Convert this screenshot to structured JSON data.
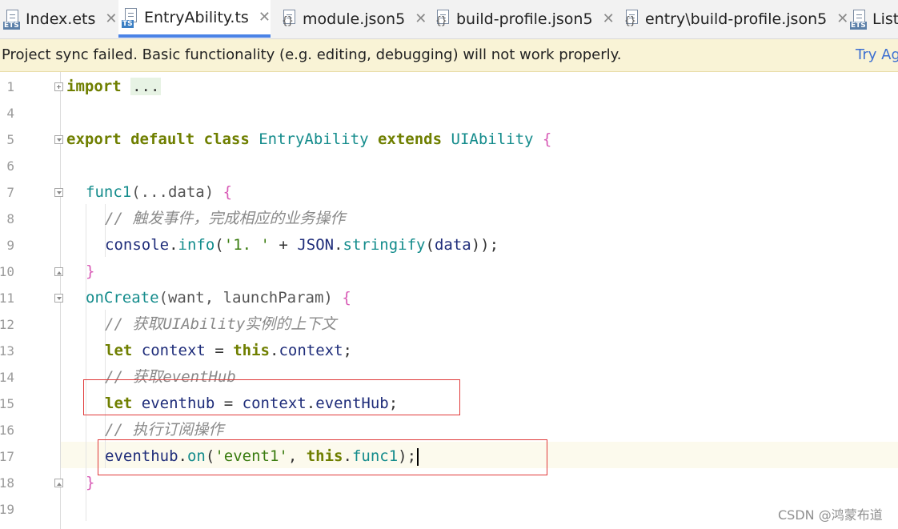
{
  "tabs": [
    {
      "label": "Index.ets",
      "type": "ETS",
      "active": false
    },
    {
      "label": "EntryAbility.ts",
      "type": "TS",
      "active": true
    },
    {
      "label": "module.json5",
      "type": "json",
      "active": false
    },
    {
      "label": "build-profile.json5",
      "type": "json",
      "active": false
    },
    {
      "label": "entry\\build-profile.json5",
      "type": "json",
      "active": false
    },
    {
      "label": "ListI",
      "type": "ETS",
      "active": false
    }
  ],
  "notice": {
    "message": "Project sync failed. Basic functionality (e.g. editing, debugging) will not work properly.",
    "action": "Try Ag"
  },
  "editor": {
    "line_numbers": [
      "1",
      "4",
      "5",
      "6",
      "7",
      "8",
      "9",
      "10",
      "11",
      "12",
      "13",
      "14",
      "15",
      "16",
      "17",
      "18",
      "19"
    ],
    "code": {
      "l1_import": "import",
      "l1_dots": "...",
      "l5_export": "export default class",
      "l5_class": "EntryAbility",
      "l5_extends": "extends",
      "l5_base": "UIAbility",
      "l5_brace": "{",
      "l7_fn": "func1",
      "l7_params": "(...data)",
      "l7_brace": "{",
      "l8_comment": "// 触发事件，完成相应的业务操作",
      "l9_console": "console",
      "l9_info": "info",
      "l9_str": "'1. '",
      "l9_json": "JSON",
      "l9_stringify": "stringify",
      "l9_arg": "data",
      "l10_brace": "}",
      "l11_fn": "onCreate",
      "l11_params": "(want, launchParam)",
      "l11_brace": "{",
      "l12_comment": "// 获取UIAbility实例的上下文",
      "l13_let": "let",
      "l13_var": "context",
      "l13_this": "this",
      "l13_prop": "context",
      "l14_comment": "// 获取eventHub",
      "l15_let": "let",
      "l15_var": "eventhub",
      "l15_obj": "context",
      "l15_prop": "eventHub",
      "l16_comment": "// 执行订阅操作",
      "l17_obj": "eventhub",
      "l17_on": "on",
      "l17_str": "'event1'",
      "l17_this": "this",
      "l17_fn": "func1",
      "l18_brace": "}"
    }
  },
  "watermark": "CSDN @鸿蒙布道",
  "colors": {
    "keyword": "#6f7f00",
    "function": "#148c8c",
    "string": "#3a7c10",
    "comment": "#8a8a8a",
    "highlight_box": "#e03a3a",
    "notice_bg": "#f9f3d6",
    "active_tab_underline": "#4b83e6"
  }
}
